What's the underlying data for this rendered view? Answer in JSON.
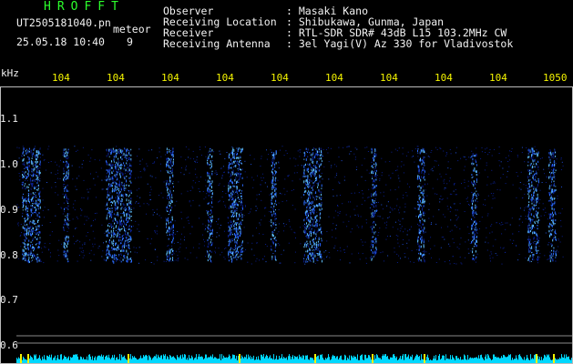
{
  "header": {
    "logo_text": "HROFFT",
    "filename": "UT2505181040.pn",
    "type_label": "meteor",
    "datetime": "25.05.18 10:40",
    "count": "9",
    "fields": [
      {
        "label": "Observer",
        "value": ": Masaki Kano"
      },
      {
        "label": "Receiving Location",
        "value": ": Shibukawa, Gunma, Japan"
      },
      {
        "label": "Receiver",
        "value": ": RTL-SDR SDR# 43dB L15 103.2MHz CW"
      },
      {
        "label": "Receiving Antenna",
        "value": ": 3el Yagi(V) Az 330 for Vladivostok"
      }
    ]
  },
  "time_axis": {
    "labels": [
      "104",
      "104",
      "104",
      "104",
      "104",
      "104",
      "104",
      "104",
      "104",
      "1050"
    ]
  },
  "freq_axis": {
    "unit": "kHz",
    "labels": [
      "1.1",
      "1.0",
      "0.9",
      "0.8",
      "0.7",
      "0.6"
    ]
  },
  "colors": {
    "background": "#000000",
    "header_text": "#f2f2f2",
    "logo": "#2cff2c",
    "time_labels": "#f4f400",
    "signal_low": "#0a1f8f",
    "signal_high": "#5fc0ff",
    "baseline": "#00d8ff"
  }
}
